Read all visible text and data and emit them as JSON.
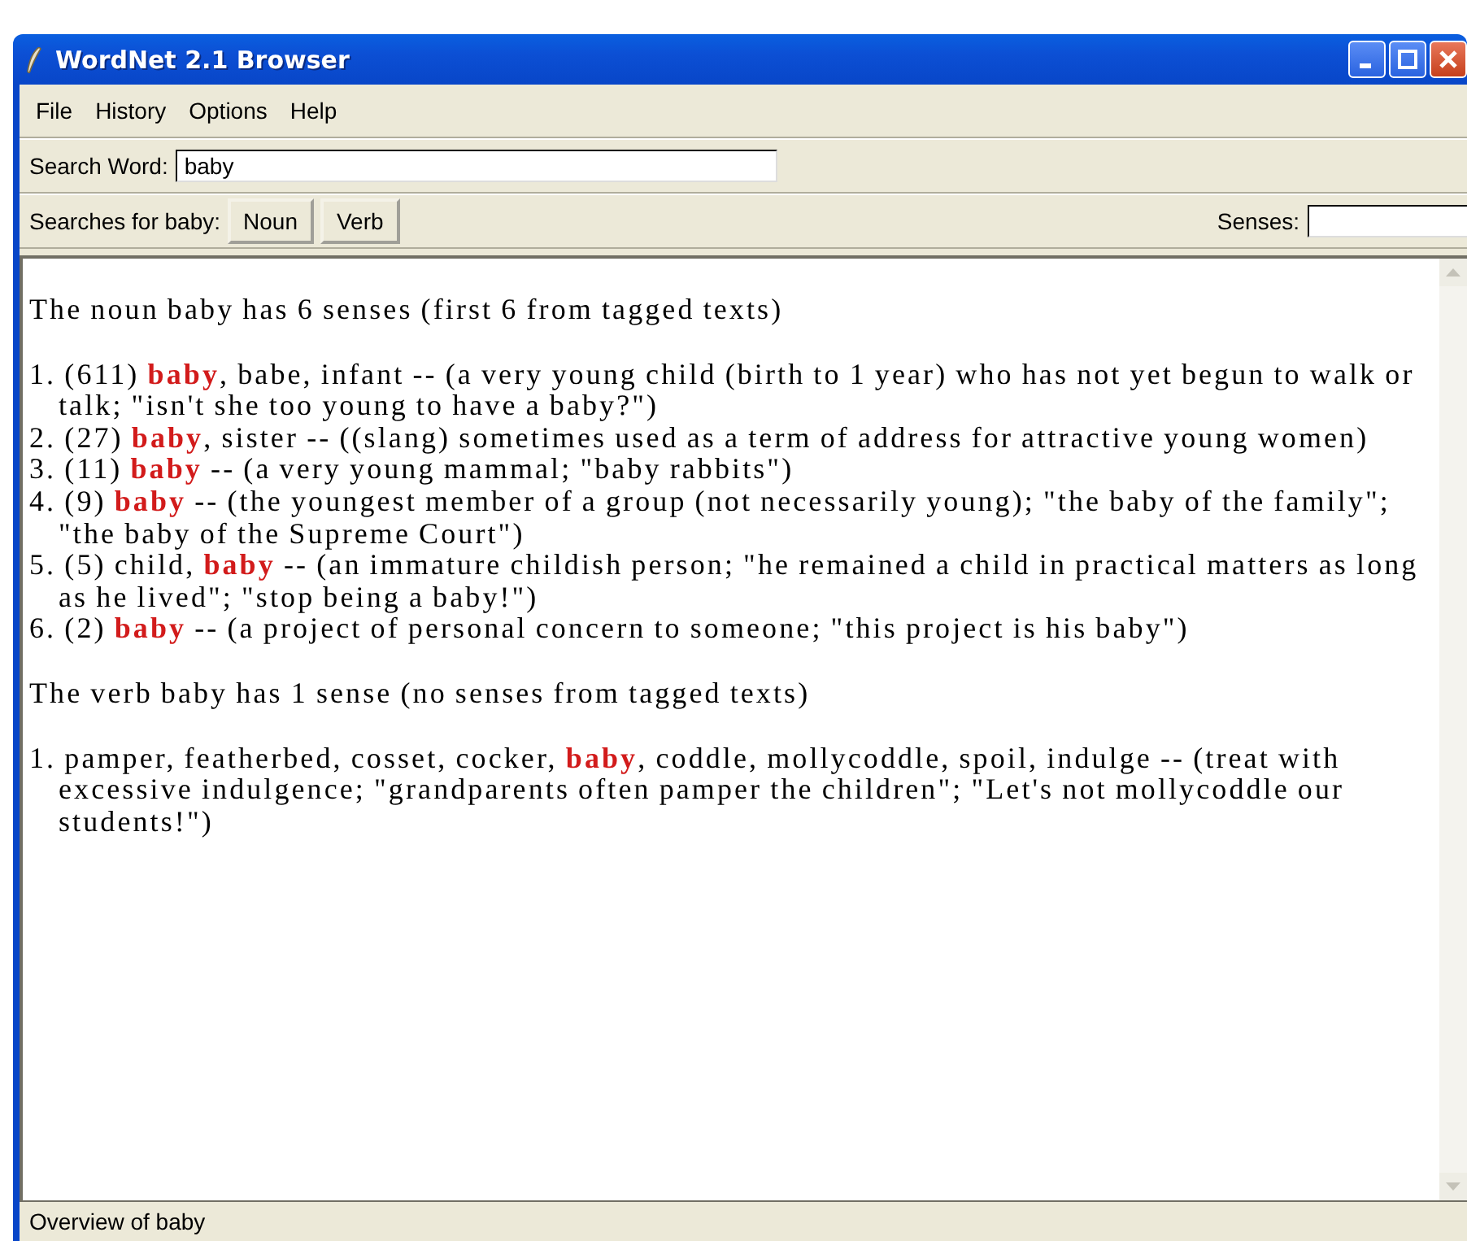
{
  "window": {
    "title": "WordNet 2.1 Browser"
  },
  "menu": [
    "File",
    "History",
    "Options",
    "Help"
  ],
  "search": {
    "label": "Search Word:",
    "value": "baby"
  },
  "searches": {
    "label": "Searches for baby:",
    "buttons": [
      "Noun",
      "Verb"
    ],
    "senses_label": "Senses:"
  },
  "results": [
    {
      "heading": "The noun baby has 6 senses (first 6 from tagged texts)",
      "senses": [
        "1. (611) **baby**, babe, infant -- (a very young child (birth to 1 year) who has not yet begun to walk or talk; \"isn't she too young to have a baby?\")",
        "2. (27) **baby**, sister -- ((slang) sometimes used as a term of address for attractive young women)",
        "3. (11) **baby** -- (a very young mammal; \"baby rabbits\")",
        "4. (9) **baby** -- (the youngest member of a group (not necessarily young); \"the baby of the family\"; \"the baby of the Supreme Court\")",
        "5. (5) child, **baby** -- (an immature childish person; \"he remained a child in practical matters as long as he lived\"; \"stop being a baby!\")",
        "6. (2) **baby** -- (a project of personal concern to someone; \"this project is his baby\")"
      ]
    },
    {
      "heading": "The verb baby has 1 sense (no senses from tagged texts)",
      "senses": [
        "1. pamper, featherbed, cosset, cocker, **baby**, coddle, mollycoddle, spoil, indulge -- (treat with excessive indulgence; \"grandparents often pamper the children\"; \"Let's not mollycoddle our students!\")"
      ]
    }
  ],
  "status_bar": "Overview of baby"
}
